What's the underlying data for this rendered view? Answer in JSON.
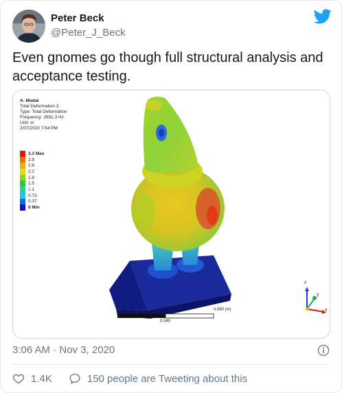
{
  "author": {
    "name": "Peter Beck",
    "handle": "@Peter_J_Beck"
  },
  "tweet": {
    "text": "Even gnomes go though full structural analysis and acceptance testing.",
    "timestamp": "3:06 AM · Nov 3, 2020",
    "likes": "1.4K",
    "conversation": "150 people are Tweeting about this"
  },
  "simulation": {
    "header_title": "A: Modal",
    "header_lines": [
      "Total Deformation 3",
      "Type: Total Deformation",
      "Frequency: 2691.3 Hz",
      "Unit: m",
      "2/07/2020 7:54 PM"
    ],
    "legend": [
      {
        "label": "3.3 Max",
        "color": "#e8120c",
        "bold": true
      },
      {
        "label": "2.9",
        "color": "#f26c0c",
        "bold": false
      },
      {
        "label": "2.6",
        "color": "#f2ae0c",
        "bold": false
      },
      {
        "label": "2.2",
        "color": "#dede0e",
        "bold": false
      },
      {
        "label": "1.8",
        "color": "#92d21a",
        "bold": false
      },
      {
        "label": "1.5",
        "color": "#2ecb3e",
        "bold": false
      },
      {
        "label": "1.1",
        "color": "#22d3a0",
        "bold": false
      },
      {
        "label": "0.73",
        "color": "#22c8e0",
        "bold": false
      },
      {
        "label": "0.37",
        "color": "#1a64e6",
        "bold": false
      },
      {
        "label": "0 Min",
        "color": "#1010c8",
        "bold": true
      }
    ],
    "scale": {
      "left": "0.000",
      "right": "0.080 (m)",
      "mid": "0.040"
    },
    "axes": {
      "x": "x",
      "y": "y",
      "z": "z"
    }
  },
  "colors": {
    "twitter_blue": "#1da1f2",
    "text_secondary": "#657786",
    "border": "#e1e8ed"
  },
  "icons": {
    "brand": "twitter-bird-icon",
    "info": "info-icon",
    "like": "heart-icon",
    "reply": "speech-bubble-icon"
  }
}
